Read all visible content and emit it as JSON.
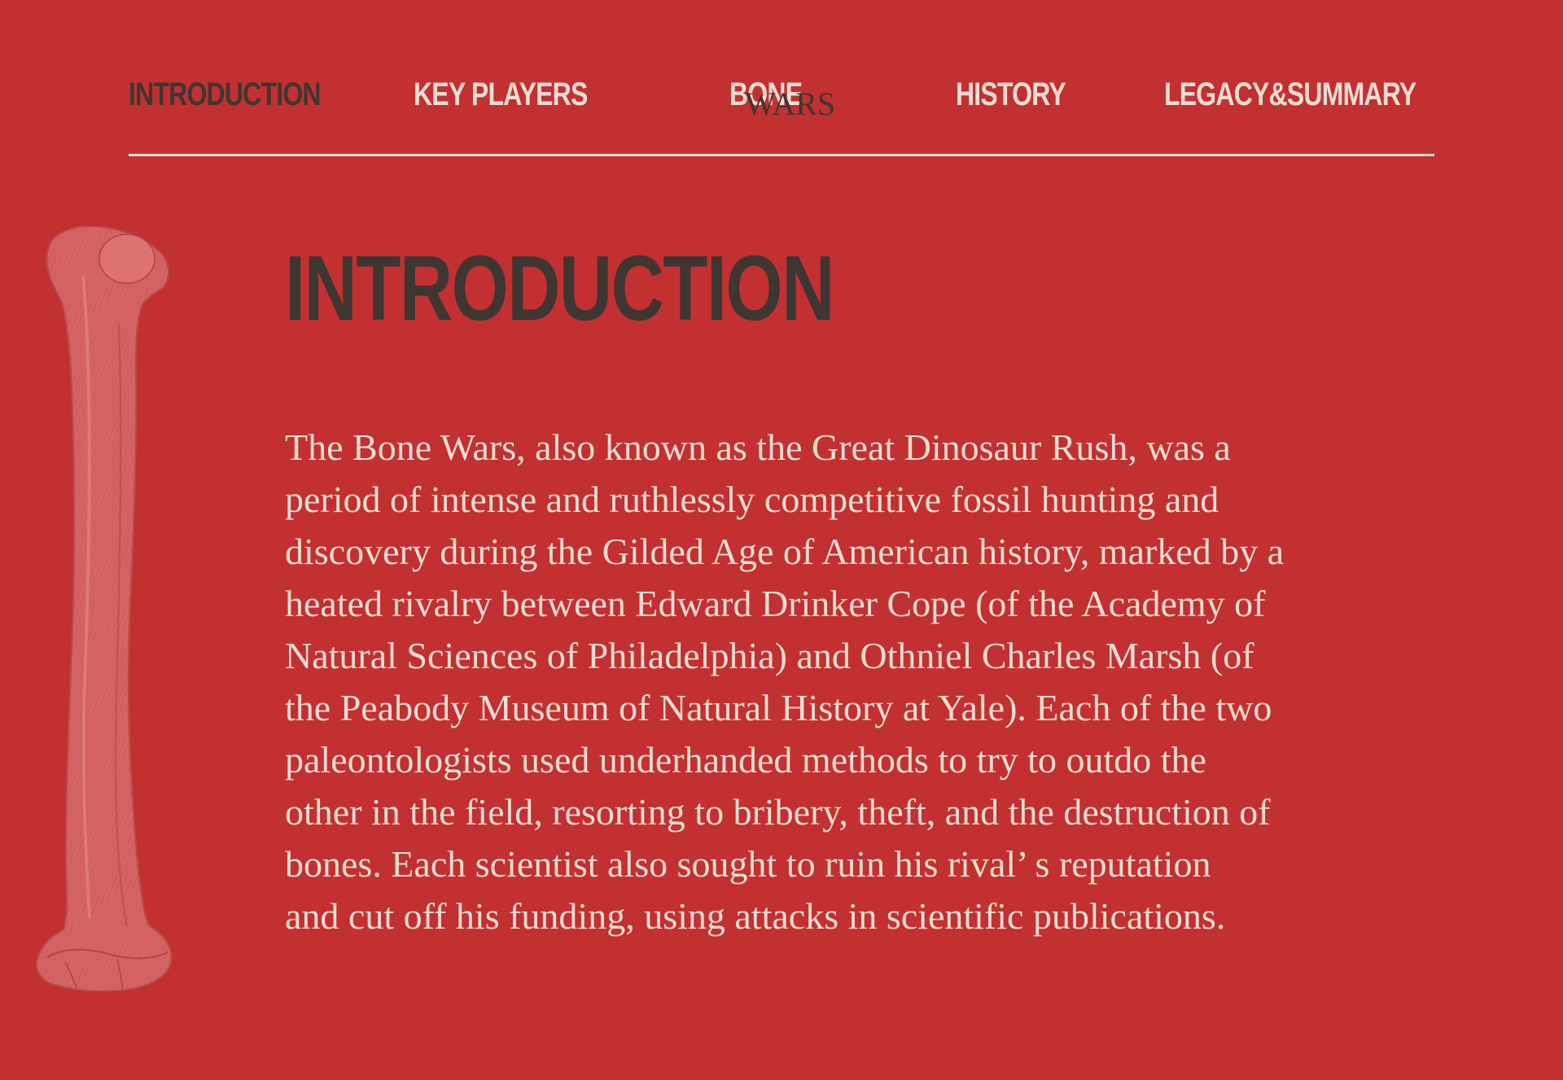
{
  "nav": {
    "items": [
      {
        "label": "INTRODUCTION",
        "active": true
      },
      {
        "label": "KEY PLAYERS",
        "active": false
      },
      {
        "label": "BONE",
        "active": false
      },
      {
        "label": "HISTORY",
        "active": false
      },
      {
        "label": "LEGACY&SUMMARY",
        "active": false
      }
    ],
    "overlay_word": "WARS"
  },
  "main": {
    "title": "INTRODUCTION",
    "lines": [
      "The Bone Wars, also known as the Great Dinosaur Rush, was a",
      "period of intense and ruthlessly competitive fossil hunting and",
      "discovery during the Gilded Age of American history, marked by a",
      "heated rivalry between Edward Drinker Cope (of the Academy of",
      "Natural Sciences of Philadelphia) and Othniel Charles Marsh (of",
      "the Peabody Museum of Natural History at Yale). Each of the two",
      "paleontologists used underhanded methods to try to outdo the",
      "other in the field, resorting to bribery, theft, and the destruction of",
      "bones. Each scientist also sought to ruin his rival’ s reputation",
      "and cut off his funding, using attacks in scientific publications."
    ]
  },
  "colors": {
    "background": "#c33031",
    "light_text": "#f0ddd3",
    "dark_text": "#3e3632",
    "bone": "#d46363"
  },
  "icons": {
    "bone": "femur-bone-illustration"
  }
}
